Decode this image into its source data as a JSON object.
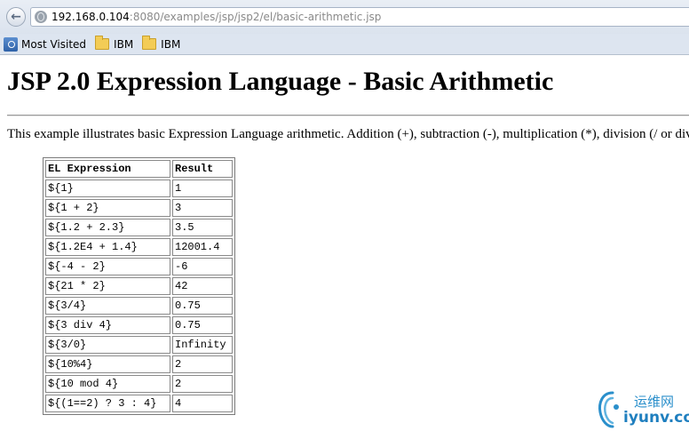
{
  "browser": {
    "back_glyph": "←",
    "url_host": "192.168.0.104",
    "url_rest": ":8080/examples/jsp/jsp2/el/basic-arithmetic.jsp",
    "bookmarks": [
      "Most Visited",
      "IBM",
      "IBM"
    ]
  },
  "page": {
    "title": "JSP 2.0 Expression Language - Basic Arithmetic",
    "intro": "This example illustrates basic Expression Language arithmetic. Addition (+), subtraction (-), multiplication (*), division (/ or div), and modulus (% or mod)",
    "table": {
      "headers": [
        "EL Expression",
        "Result"
      ],
      "rows": [
        [
          "${1}",
          "1"
        ],
        [
          "${1 + 2}",
          "3"
        ],
        [
          "${1.2 + 2.3}",
          "3.5"
        ],
        [
          "${1.2E4 + 1.4}",
          "12001.4"
        ],
        [
          "${-4 - 2}",
          "-6"
        ],
        [
          "${21 * 2}",
          "42"
        ],
        [
          "${3/4}",
          "0.75"
        ],
        [
          "${3 div 4}",
          "0.75"
        ],
        [
          "${3/0}",
          "Infinity"
        ],
        [
          "${10%4}",
          "2"
        ],
        [
          "${10 mod 4}",
          "2"
        ],
        [
          "${(1==2) ? 3 : 4}",
          "4"
        ]
      ]
    }
  },
  "watermark": {
    "cn": "运维网",
    "en": "iyunv.com"
  },
  "colors": {
    "chrome_bg": "#dbe3ee",
    "watermark_blue": "#1f7fbf"
  }
}
